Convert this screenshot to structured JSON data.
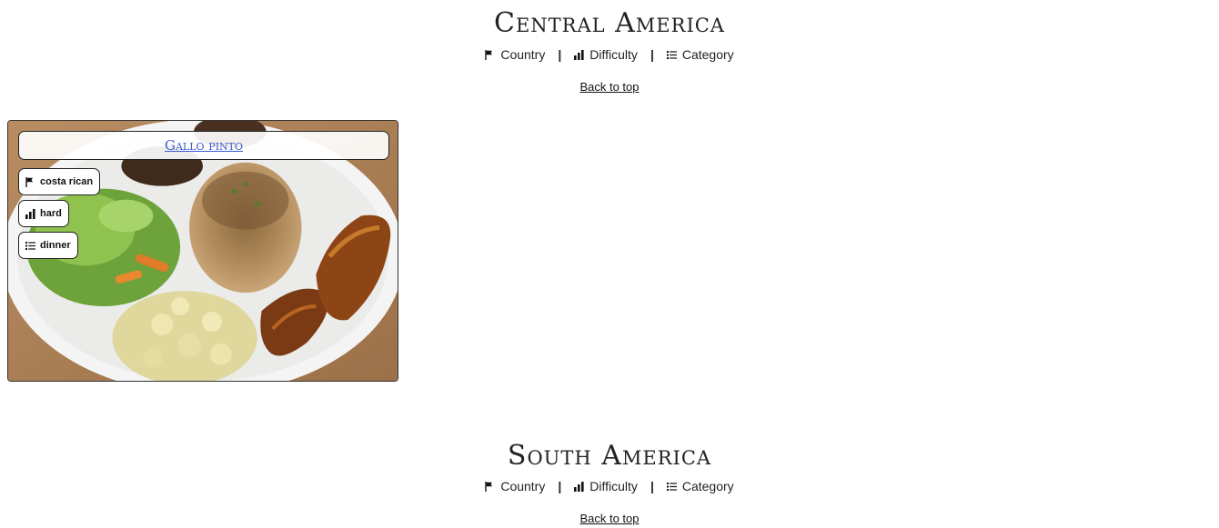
{
  "sections": [
    {
      "title": "Central America",
      "filters": {
        "country": "Country",
        "difficulty": "Difficulty",
        "category": "Category",
        "separator": "|"
      },
      "back_to_top": "Back to top"
    },
    {
      "title": "South America",
      "filters": {
        "country": "Country",
        "difficulty": "Difficulty",
        "category": "Category",
        "separator": "|"
      },
      "back_to_top": "Back to top"
    }
  ],
  "recipe_card": {
    "title": "Gallo pinto",
    "tags": {
      "country": "costa rican",
      "difficulty": "hard",
      "category": "dinner"
    }
  },
  "icons": {
    "country": "flag-icon",
    "difficulty": "signal-bars-icon",
    "category": "list-icon"
  }
}
